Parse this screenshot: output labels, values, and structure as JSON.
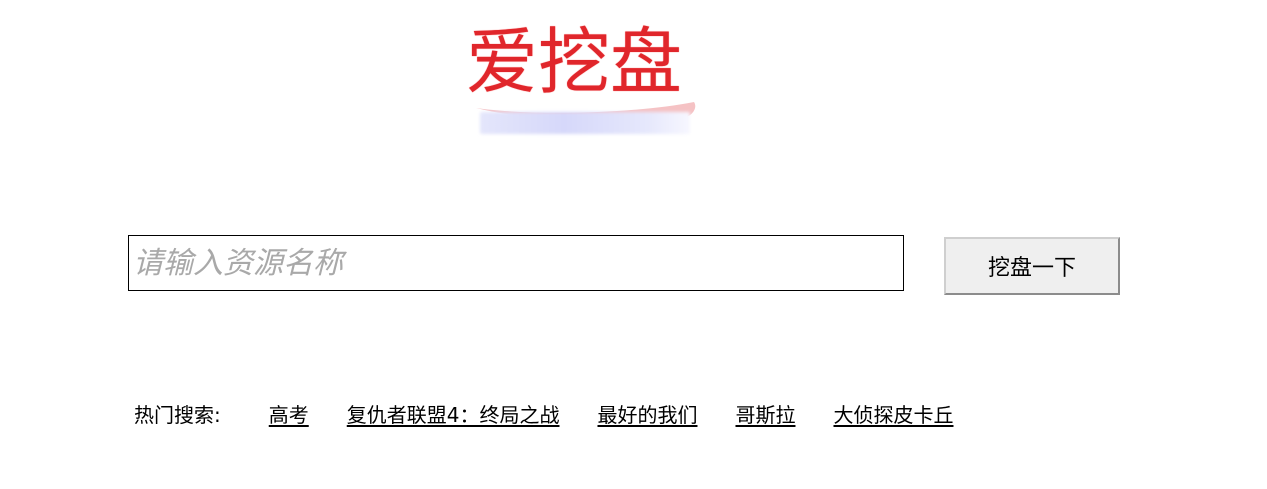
{
  "logo": {
    "text": "爱挖盘",
    "color": "#e0262b"
  },
  "search": {
    "placeholder": "请输入资源名称",
    "value": "",
    "button_label": "挖盘一下"
  },
  "hot_searches": {
    "label": "热门搜索:",
    "items": [
      "高考",
      "复仇者联盟4：终局之战",
      "最好的我们",
      "哥斯拉",
      "大侦探皮卡丘"
    ]
  }
}
